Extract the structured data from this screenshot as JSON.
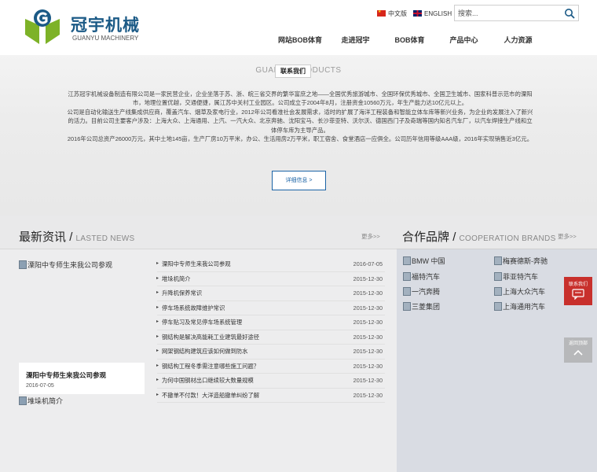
{
  "header": {
    "logo_cn": "冠宇机械",
    "logo_en": "GUANYU MACHINERY",
    "lang_cn": "中文版",
    "lang_en": "ENGLISH",
    "search_placeholder": "搜索..."
  },
  "nav": [
    "网站BOB体育",
    "走进冠宇",
    "BOB体育",
    "产品中心",
    "人力资源"
  ],
  "about": {
    "title": "GUANYU PRODUCTS",
    "tooltip": "联系我们",
    "paragraphs": [
      "江苏冠宇机械设备制造有限公司是一家民营企业，企业坐落于苏、浙、皖三省交界的繁华富庶之地——全国优秀旅游城市、全国环保优秀城市、全国卫生城市、国家科普示范市的溧阳市，地理位置优越，交通便捷，属江苏中关村工业园区。公司成立于2004年8月，注册资金10560万元，年生产能力达10亿元以上。",
      "公司是自动化输送生产线集成供应商，覆盖汽车、烟草及家电行业，2012年公司看准社会发展需求，适时的扩展了海洋工程装备和智能立体车库等新兴业务，为企业的发展注入了新兴的活力。目前公司主要客户涉及：上海大众、上海通用、上汽、一汽大众、北京奔驰、沈阳宝马、长沙菲亚特、沃尔沃、德国西门子及奇瑞等国内知名汽车厂，以汽车焊接生产线和立体停车库为主导产品。",
      "2016年公司总资产26000万元，其中土地145亩，生产厂房10万平米，办公、生活用房2万平米，职工宿舍、食堂酒店一应俱全。公司历年信用等级AAA级，2016年实现销售近3亿元。"
    ],
    "more_label": "详细信息 >"
  },
  "news": {
    "title_cn": "最新资讯",
    "sep": "/",
    "title_en": "LASTED NEWS",
    "more": "更多>>",
    "pic_alt": "溧阳中专师生来我公司参观",
    "card_title": "溧阳中专师生来我公司参观",
    "card_date": "2016-07-05",
    "pic2_alt": "堆垛机简介",
    "items": [
      {
        "title": "溧阳中专师生来我公司参观",
        "date": "2016-07-05"
      },
      {
        "title": "堆垛机简介",
        "date": "2015-12-30"
      },
      {
        "title": "升降机保养常识",
        "date": "2015-12-30"
      },
      {
        "title": "停车场系统故障维护常识",
        "date": "2015-12-30"
      },
      {
        "title": "停车贴习及常见停车场系统管理",
        "date": "2015-12-30"
      },
      {
        "title": "钢结构是解决高能耗工业建筑最好途径",
        "date": "2015-12-30"
      },
      {
        "title": "网架钢结构建筑应该如何做到防水",
        "date": "2015-12-30"
      },
      {
        "title": "钢结构工程冬季需注意哪些施工问题？",
        "date": "2015-12-30"
      },
      {
        "title": "为何中国钢材出口继续较大数量规模",
        "date": "2015-12-30"
      },
      {
        "title": "不撤单不付款！大洋造船撤单纠纷了解",
        "date": "2015-12-30"
      }
    ]
  },
  "brands": {
    "title_cn": "合作品牌",
    "sep": "/",
    "title_en": "COOPERATION BRANDS",
    "more": "更多>>",
    "items": [
      "BMW 中国",
      "梅赛德斯-奔驰",
      "福特汽车",
      "菲亚特汽车",
      "一汽奔腾",
      "上海大众汽车",
      "三菱集团",
      "上海通用汽车"
    ]
  },
  "float": {
    "contact": "联系我们",
    "top": "返回顶部"
  },
  "colors": {
    "brand_blue": "#1b5a86",
    "logo_green": "#7db227",
    "accent_red": "#c8302c",
    "link_blue": "#1b63a6"
  }
}
